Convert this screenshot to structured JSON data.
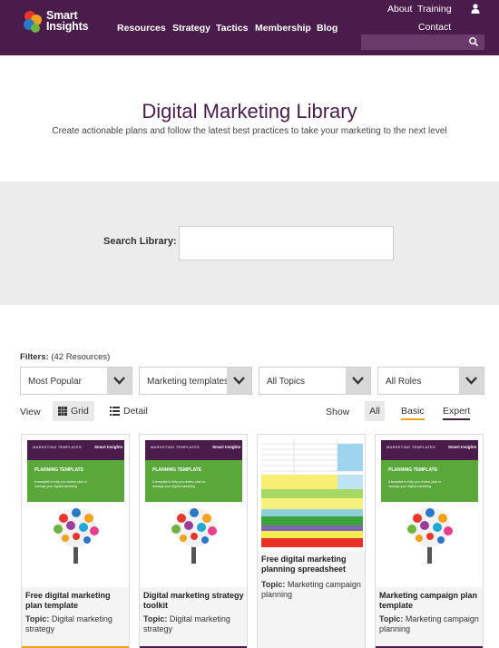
{
  "header": {
    "logo_text_line1": "Smart",
    "logo_text_line2": "Insights",
    "nav": [
      "Resources",
      "Strategy",
      "Tactics",
      "Membership",
      "Blog"
    ],
    "top_links": [
      "About",
      "Training",
      "Contact"
    ],
    "search_placeholder": ""
  },
  "page": {
    "title": "Digital Marketing Library",
    "subtitle": "Create actionable plans and follow the latest best practices to take your marketing to the next level"
  },
  "search": {
    "label": "Search Library:",
    "value": ""
  },
  "filters": {
    "label": "Filters:",
    "count": "(42 Resources)",
    "dropdowns": [
      {
        "selected": "Most Popular"
      },
      {
        "selected": "Marketing templates"
      },
      {
        "selected": "All Topics"
      },
      {
        "selected": "All Roles"
      }
    ]
  },
  "view": {
    "label": "View",
    "grid": "Grid",
    "detail": "Detail"
  },
  "show": {
    "label": "Show",
    "all": "All",
    "basic": "Basic",
    "expert": "Expert"
  },
  "cards": [
    {
      "title": "Free digital marketing plan template",
      "topic_label": "Topic:",
      "topic": "Digital marketing strategy",
      "level_color": "#f0a21a",
      "thumb_header": "MARKETING TEMPLATES",
      "thumb_title": "PLANNING TEMPLATE",
      "thumb_desc": "A template to help you review, plan or manage your digital marketing",
      "thumb_brand": "Smart Insights"
    },
    {
      "title": "Digital marketing strategy toolkit",
      "topic_label": "Topic:",
      "topic": "Digital marketing strategy",
      "level_color": "#4a1c4c",
      "thumb_header": "MARKETING TEMPLATES",
      "thumb_title": "PLANNING TEMPLATE",
      "thumb_desc": "A template to help you review, plan or manage your digital marketing",
      "thumb_brand": "Smart Insights"
    },
    {
      "title": "Free digital marketing planning spreadsheet",
      "topic_label": "Topic:",
      "topic": "Marketing campaign planning",
      "level_color": "#ffffff"
    },
    {
      "title": "Marketing campaign plan template",
      "topic_label": "Topic:",
      "topic": "Marketing campaign planning",
      "level_color": "#4a1c4c",
      "thumb_header": "MARKETING TEMPLATES",
      "thumb_title": "PLANNING TEMPLATE",
      "thumb_desc": "A template to help you review, plan or manage your digital marketing",
      "thumb_brand": "Smart Insights"
    }
  ],
  "colors": {
    "brand_purple": "#4a1c4c",
    "accent_orange": "#f0a21a",
    "template_green": "#5aa83a"
  }
}
